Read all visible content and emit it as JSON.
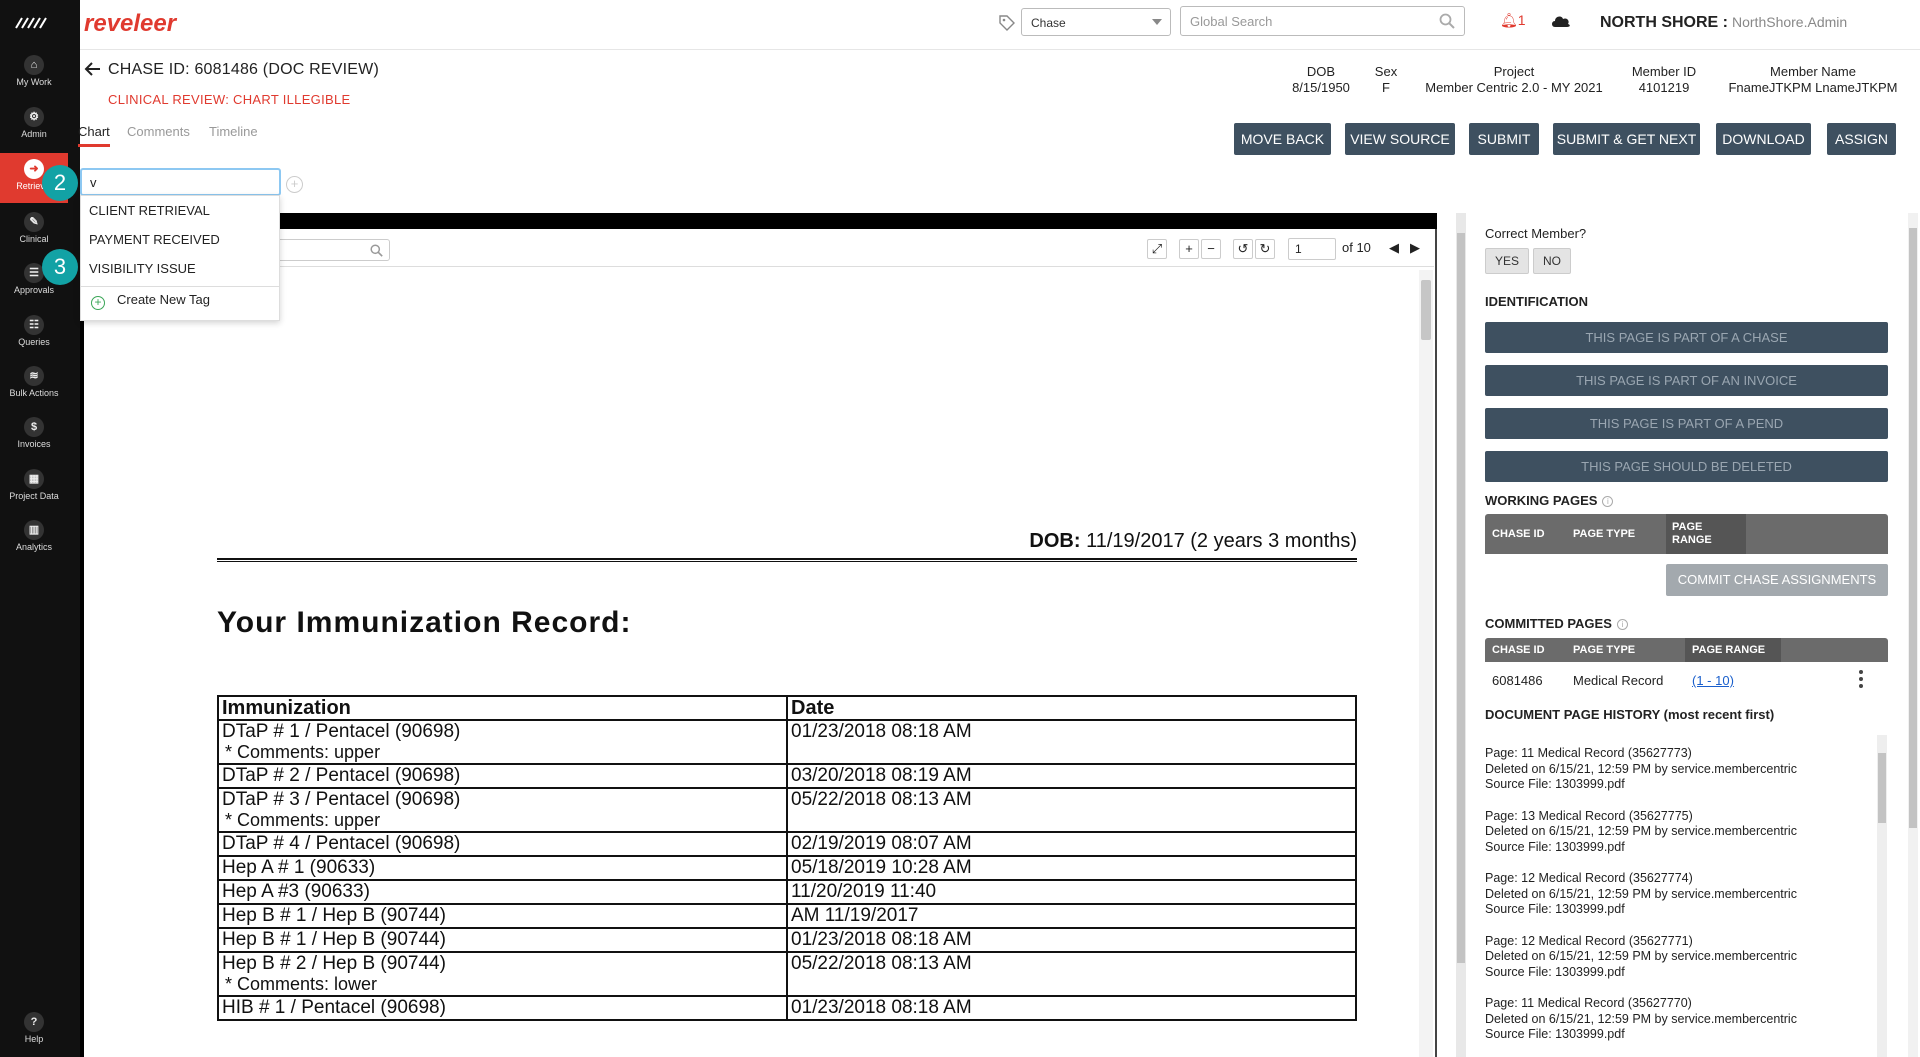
{
  "app": {
    "brand": "reveleer"
  },
  "sidebar": {
    "items": [
      {
        "label": "My Work",
        "glyph": "⌂"
      },
      {
        "label": "Admin",
        "glyph": "⚙"
      },
      {
        "label": "Retrieval",
        "glyph": "➜"
      },
      {
        "label": "Clinical",
        "glyph": "✎"
      },
      {
        "label": "Approvals",
        "glyph": "☰"
      },
      {
        "label": "Queries",
        "glyph": "☷"
      },
      {
        "label": "Bulk Actions",
        "glyph": "≋"
      },
      {
        "label": "Invoices",
        "glyph": "$"
      },
      {
        "label": "Project Data",
        "glyph": "▦"
      },
      {
        "label": "Analytics",
        "glyph": "▥"
      }
    ],
    "help_label": "Help",
    "help_glyph": "?"
  },
  "topbar": {
    "chase_select_value": "Chase",
    "search_placeholder": "Global Search",
    "notification_count": "1",
    "org_name": "NORTH SHORE :",
    "user_name": "NorthShore.Admin"
  },
  "header": {
    "chase_title": "CHASE ID: 6081486 (DOC REVIEW)",
    "review_status": "CLINICAL REVIEW: CHART ILLEGIBLE",
    "tabs": [
      "Chart",
      "Comments",
      "Timeline"
    ]
  },
  "member": {
    "dob_label": "DOB",
    "dob": "8/15/1950",
    "sex_label": "Sex",
    "sex": "F",
    "project_label": "Project",
    "project": "Member Centric 2.0 - MY 2021",
    "member_id_label": "Member ID",
    "member_id": "4101219",
    "member_name_label": "Member Name",
    "member_name": "FnameJTKPM LnameJTKPM"
  },
  "actions": [
    "MOVE BACK",
    "VIEW SOURCE",
    "SUBMIT",
    "SUBMIT & GET NEXT",
    "DOWNLOAD",
    "ASSIGN"
  ],
  "tag_input": {
    "value": "v",
    "options": [
      "CLIENT RETRIEVAL",
      "PAYMENT RECEIVED",
      "VISIBILITY ISSUE"
    ],
    "create_label": "Create New Tag"
  },
  "badges": [
    "2",
    "3"
  ],
  "viewer": {
    "page": "1",
    "of_label": "of 10"
  },
  "document": {
    "dob_label": "DOB:",
    "dob_value": "11/19/2017 (2 years 3 months)",
    "title": "Your Immunization Record:",
    "col_headers": [
      "Immunization",
      "Date"
    ],
    "rows": [
      {
        "name": "DTaP # 1 / Pentacel (90698)",
        "comment": "* Comments: upper",
        "date": "01/23/2018 08:18 AM"
      },
      {
        "name": "DTaP # 2 / Pentacel (90698)",
        "comment": "",
        "date": "03/20/2018 08:19 AM"
      },
      {
        "name": "DTaP # 3 / Pentacel (90698)",
        "comment": "* Comments: upper",
        "date": "05/22/2018 08:13 AM"
      },
      {
        "name": "DTaP # 4 / Pentacel (90698)",
        "comment": "",
        "date": "02/19/2019 08:07 AM"
      },
      {
        "name": "Hep A # 1 (90633)",
        "comment": "",
        "date": "05/18/2019 10:28 AM"
      },
      {
        "name": "Hep A #3 (90633)",
        "comment": "",
        "date": "11/20/2019 11:40"
      },
      {
        "name": "Hep B # 1 / Hep B (90744)",
        "comment": "",
        "date": "AM 11/19/2017"
      },
      {
        "name": "Hep B # 1 / Hep B (90744)",
        "comment": "",
        "date": "01/23/2018 08:18 AM"
      },
      {
        "name": "Hep B # 2 / Hep B (90744)",
        "comment": "* Comments: lower",
        "date": "05/22/2018 08:13 AM"
      },
      {
        "name": "HIB # 1 / Pentacel (90698)",
        "comment": "",
        "date": "01/23/2018 08:18 AM"
      }
    ]
  },
  "panel": {
    "correct_member_q": "Correct Member?",
    "yes": "YES",
    "no": "NO",
    "identification": "IDENTIFICATION",
    "id_buttons": [
      "THIS PAGE IS PART OF A CHASE",
      "THIS PAGE IS PART OF AN INVOICE",
      "THIS PAGE IS PART OF A PEND",
      "THIS PAGE SHOULD BE DELETED"
    ],
    "working_pages": "WORKING PAGES",
    "wp_cols": [
      "CHASE ID",
      "PAGE TYPE",
      "PAGE",
      "RANGE"
    ],
    "commit_btn": "COMMIT CHASE ASSIGNMENTS",
    "committed_pages": "COMMITTED PAGES",
    "cp_cols": [
      "CHASE ID",
      "PAGE TYPE",
      "PAGE RANGE"
    ],
    "cp_row": {
      "chase_id": "6081486",
      "page_type": "Medical Record",
      "page_range": "(1 - 10)"
    },
    "history_title": "DOCUMENT PAGE HISTORY (most recent first)",
    "history": [
      {
        "page": "Page: 11 Medical Record (35627773)",
        "deleted": "Deleted on 6/15/21, 12:59 PM by service.membercentric",
        "source": "Source File: 1303999.pdf"
      },
      {
        "page": "Page: 13 Medical Record (35627775)",
        "deleted": "Deleted on 6/15/21, 12:59 PM by service.membercentric",
        "source": "Source File: 1303999.pdf"
      },
      {
        "page": "Page: 12 Medical Record (35627774)",
        "deleted": "Deleted on 6/15/21, 12:59 PM by service.membercentric",
        "source": "Source File: 1303999.pdf"
      },
      {
        "page": "Page: 12 Medical Record (35627771)",
        "deleted": "Deleted on 6/15/21, 12:59 PM by service.membercentric",
        "source": "Source File: 1303999.pdf"
      },
      {
        "page": "Page: 11 Medical Record (35627770)",
        "deleted": "Deleted on 6/15/21, 12:59 PM by service.membercentric",
        "source": "Source File: 1303999.pdf"
      }
    ]
  }
}
